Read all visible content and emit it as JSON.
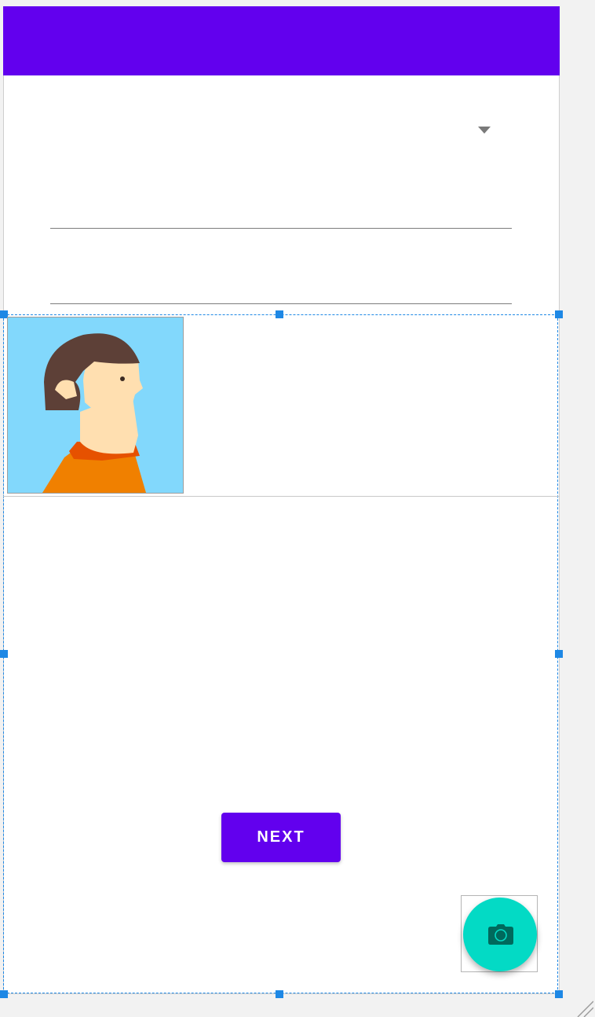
{
  "app_bar": {
    "color": "#6200ee"
  },
  "form": {
    "spinner_value": "",
    "field_1_value": "",
    "field_2_value": ""
  },
  "profile": {
    "image_description": "avatar-placeholder"
  },
  "actions": {
    "next_label": "NEXT",
    "fab_icon": "camera-icon"
  },
  "colors": {
    "primary": "#6200ee",
    "secondary": "#03dac5",
    "selection": "#1e88e5"
  }
}
